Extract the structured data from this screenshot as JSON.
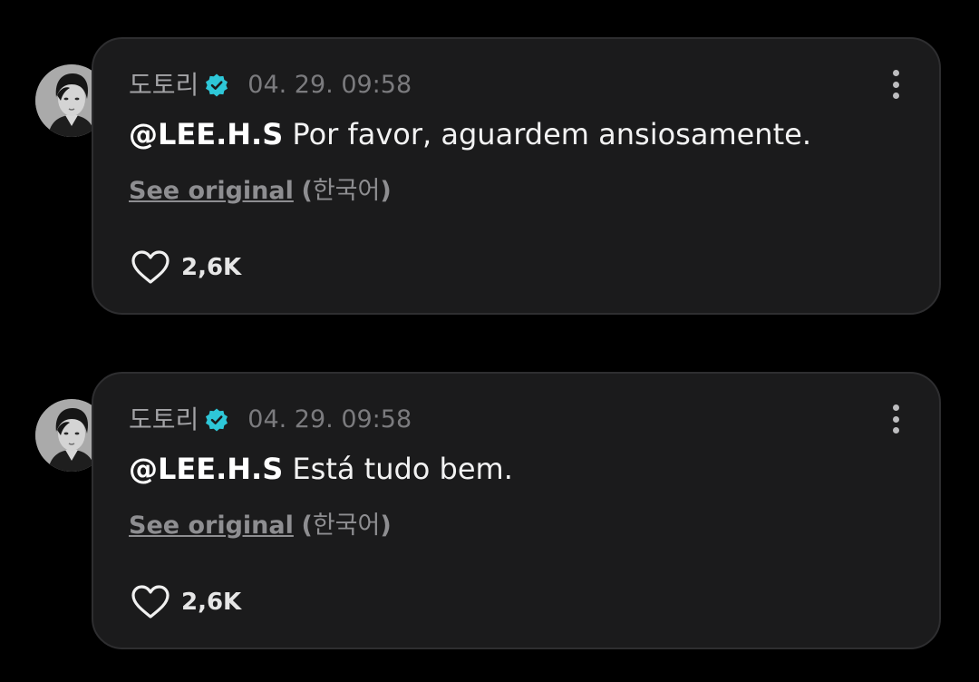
{
  "colors": {
    "background": "#000000",
    "card": "#1b1b1c",
    "card_border": "#2e2e30",
    "verified_badge": "#2ec7d8",
    "username": "#a3a3a6",
    "timestamp": "#7b7b7e",
    "link": "#8e8e91"
  },
  "comments": [
    {
      "avatar_icon": "user-avatar",
      "username": "도토리",
      "verified": true,
      "verified_icon": "verified-badge-icon",
      "timestamp": "04. 29. 09:58",
      "mention": "@LEE.H.S",
      "text": " Por favor, aguardem ansiosamente.",
      "see_original_label": "See original",
      "paren_open": "(",
      "language": "한국어",
      "paren_close": ")",
      "like_icon": "heart-outline-icon",
      "like_count": "2,6K",
      "more_icon": "more-vertical-icon"
    },
    {
      "avatar_icon": "user-avatar",
      "username": "도토리",
      "verified": true,
      "verified_icon": "verified-badge-icon",
      "timestamp": "04. 29. 09:58",
      "mention": "@LEE.H.S",
      "text": " Está tudo bem.",
      "see_original_label": "See original",
      "paren_open": "(",
      "language": "한국어",
      "paren_close": ")",
      "like_icon": "heart-outline-icon",
      "like_count": "2,6K",
      "more_icon": "more-vertical-icon"
    }
  ]
}
